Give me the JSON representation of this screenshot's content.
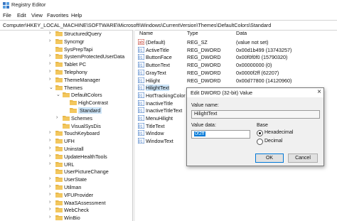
{
  "window": {
    "title": "Registry Editor",
    "icon": "registry-icon"
  },
  "menu": [
    "File",
    "Edit",
    "View",
    "Favorites",
    "Help"
  ],
  "address": "Computer\\HKEY_LOCAL_MACHINE\\SOFTWARE\\Microsoft\\Windows\\CurrentVersion\\Themes\\DefaultColors\\Standard",
  "tree": [
    {
      "label": "StructuredQuery"
    },
    {
      "label": "Syncmgr"
    },
    {
      "label": "SysPrepTapi"
    },
    {
      "label": "SystemProtectedUserData"
    },
    {
      "label": "Tablet PC"
    },
    {
      "label": "Telephony"
    },
    {
      "label": "ThemeManager"
    },
    {
      "label": "Themes"
    },
    {
      "label": "DefaultColors"
    },
    {
      "label": "HighContrast"
    },
    {
      "label": "Standard"
    },
    {
      "label": "Schemes"
    },
    {
      "label": "VisualSysDis"
    },
    {
      "label": "TouchKeyboard"
    },
    {
      "label": "UFH"
    },
    {
      "label": "Uninstall"
    },
    {
      "label": "UpdateHealthTools"
    },
    {
      "label": "URL"
    },
    {
      "label": "UserPictureChange"
    },
    {
      "label": "UserState"
    },
    {
      "label": "Utilman"
    },
    {
      "label": "VFUProvider"
    },
    {
      "label": "WaaSAssessment"
    },
    {
      "label": "WebCheck"
    },
    {
      "label": "WinBio"
    }
  ],
  "columns": {
    "name": "Name",
    "type": "Type",
    "data": "Data"
  },
  "values": [
    {
      "name": "(Default)",
      "type": "REG_SZ",
      "data": "(value not set)",
      "icon": "string-value-icon"
    },
    {
      "name": "ActiveTitle",
      "type": "REG_DWORD",
      "data": "0x00d1b499 (13743257)",
      "icon": "binary-value-icon"
    },
    {
      "name": "ButtonFace",
      "type": "REG_DWORD",
      "data": "0x00f0f0f0 (15790320)",
      "icon": "binary-value-icon"
    },
    {
      "name": "ButtonText",
      "type": "REG_DWORD",
      "data": "0x00000000 (0)",
      "icon": "binary-value-icon"
    },
    {
      "name": "GrayText",
      "type": "REG_DWORD",
      "data": "0x0000f2ff (62207)",
      "icon": "binary-value-icon"
    },
    {
      "name": "Hilight",
      "type": "REG_DWORD",
      "data": "0x00d77800 (14120960)",
      "icon": "binary-value-icon"
    },
    {
      "name": "HilightText",
      "type": "",
      "data": "",
      "icon": "binary-value-icon"
    },
    {
      "name": "HotTrackingColor",
      "type": "",
      "data": "",
      "icon": "binary-value-icon"
    },
    {
      "name": "InactiveTitle",
      "type": "",
      "data": "",
      "icon": "binary-value-icon"
    },
    {
      "name": "InactiveTitleText",
      "type": "",
      "data": "",
      "icon": "binary-value-icon"
    },
    {
      "name": "MenuHilight",
      "type": "",
      "data": "",
      "icon": "binary-value-icon"
    },
    {
      "name": "TitleText",
      "type": "",
      "data": "",
      "icon": "binary-value-icon"
    },
    {
      "name": "Window",
      "type": "",
      "data": "",
      "icon": "binary-value-icon"
    },
    {
      "name": "WindowText",
      "type": "",
      "data": "",
      "icon": "binary-value-icon"
    }
  ],
  "dialog": {
    "title": "Edit DWORD (32-bit) Value",
    "value_name_label": "Value name:",
    "value_name": "HilightText",
    "value_data_label": "Value data:",
    "value_data": "0f2ff",
    "base_label": "Base",
    "hex_label": "Hexadecimal",
    "dec_label": "Decimal",
    "ok": "OK",
    "cancel": "Cancel"
  },
  "colors": {
    "selection": "#cce4f7",
    "folder": "#e8b84a",
    "accent": "#0078d7"
  }
}
